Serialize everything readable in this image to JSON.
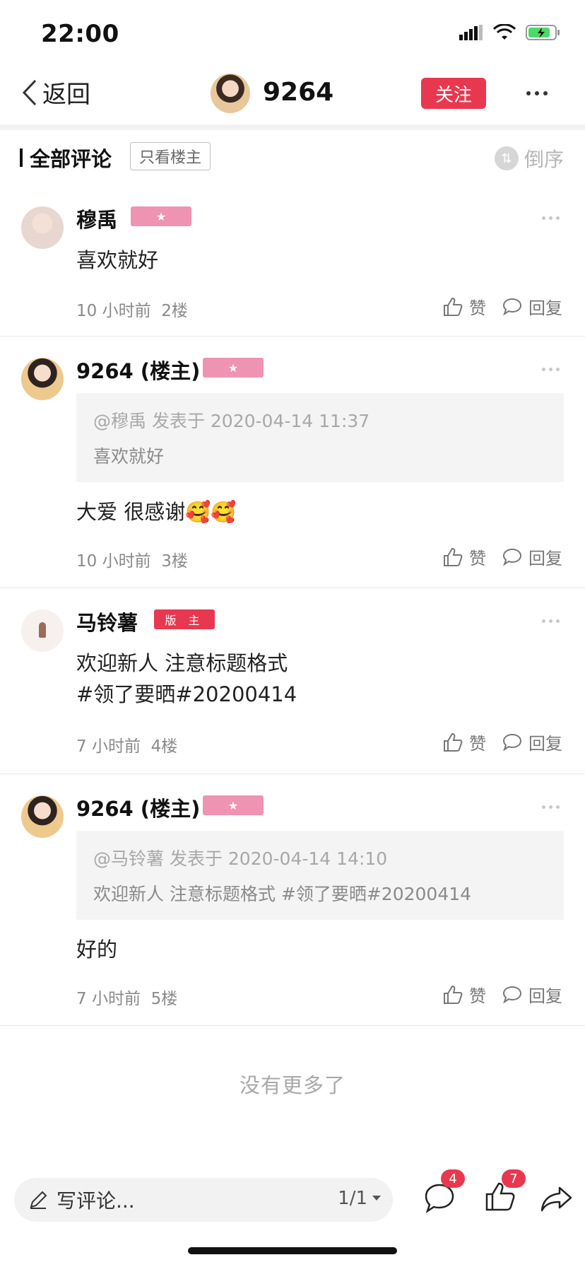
{
  "status_bar": {
    "time": "22:00"
  },
  "header": {
    "back_label": "返回",
    "username": "9264",
    "follow_label": "关注"
  },
  "comments_header": {
    "title": "全部评论",
    "only_host_label": "只看楼主",
    "sort_label": "倒序"
  },
  "comments": [
    {
      "username": "穆禹",
      "badge": "star",
      "text": "喜欢就好",
      "time": "10 小时前",
      "floor": "2楼",
      "like_label": "赞",
      "reply_label": "回复"
    },
    {
      "username": "9264 (楼主)",
      "badge": "star",
      "quote_head": "@穆禹 发表于 2020-04-14 11:37",
      "quote_body": "喜欢就好",
      "text": "大爱  很感谢🥰🥰",
      "time": "10 小时前",
      "floor": "3楼",
      "like_label": "赞",
      "reply_label": "回复"
    },
    {
      "username": "马铃薯",
      "badge_label": "版 主",
      "text_line1": "欢迎新人 注意标题格式",
      "text_line2": "#领了要晒#20200414",
      "time": "7 小时前",
      "floor": "4楼",
      "like_label": "赞",
      "reply_label": "回复"
    },
    {
      "username": "9264 (楼主)",
      "badge": "star",
      "quote_head": "@马铃薯 发表于 2020-04-14 14:10",
      "quote_body": "欢迎新人 注意标题格式 #领了要晒#20200414",
      "text": "好的",
      "time": "7 小时前",
      "floor": "5楼",
      "like_label": "赞",
      "reply_label": "回复"
    }
  ],
  "footer": {
    "no_more": "没有更多了"
  },
  "bottom_bar": {
    "placeholder": "写评论...",
    "pager": "1/1",
    "comment_count": "4",
    "like_count": "7"
  },
  "colors": {
    "accent": "#e8384f",
    "badge_pink": "#ee93b1"
  },
  "icons": [
    "signal-icon",
    "wifi-icon",
    "battery-icon",
    "back-icon",
    "more-icon",
    "sort-icon",
    "like-icon",
    "reply-icon",
    "pen-icon",
    "comment-icon",
    "thumb-icon",
    "share-icon"
  ]
}
